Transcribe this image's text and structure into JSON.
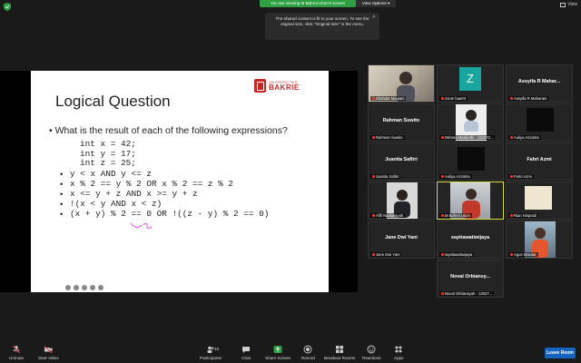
{
  "top": {
    "banner": "You are viewing M Bahrul Ulum's screen",
    "view_options": "View Options",
    "view_label": "View"
  },
  "tooltip": {
    "text": "The shared content is fit to your screen. To see the original size, click \"Original size\" in the menu."
  },
  "slide": {
    "title": "Logical Question",
    "logo_university": "UNIVERSITAS",
    "logo_name": "BAKRIE",
    "question": "• What is the result of each of the following expressions?",
    "code": [
      "int x = 42;",
      "int y = 17;",
      "int z = 25;"
    ],
    "expressions": [
      "y < x AND y <= z",
      "x % 2 == y % 2 OR x % 2 == z % 2",
      "x <= y + z AND x >= y + z",
      "!(x < y AND x < z)",
      "(x + y) % 2 == 0 OR !((z - y) % 2 == 0)"
    ]
  },
  "gallery": [
    {
      "name": "",
      "label": "Shahdat Maulani"
    },
    {
      "name": "",
      "label": "zoom baa04",
      "avatar_letter": "Z"
    },
    {
      "name": "Assyifa R Mahar...",
      "label": "Assyifa R Maharani"
    },
    {
      "name": "Rahman Suwito",
      "label": "Rahman Suwito"
    },
    {
      "name": "",
      "label": "Debora Marianthi - 122072..."
    },
    {
      "name": "",
      "label": "Auliya Azzahra"
    },
    {
      "name": "Juanita Safitri",
      "label": "Juanita Safitri"
    },
    {
      "name": "",
      "label": "Auliya Azzahra"
    },
    {
      "name": "Fahri Azmi",
      "label": "Fahri Azmi"
    },
    {
      "name": "",
      "label": "Afifi Nadiansyah"
    },
    {
      "name": "",
      "label": "M Bahrul Ulum"
    },
    {
      "name": "",
      "label": "Rian Nispradi"
    },
    {
      "name": "Jane Dwi Yani",
      "label": "Jane Dwi Yani"
    },
    {
      "name": "septiawatiwijaya",
      "label": "septiawatiwijaya"
    },
    {
      "name": "",
      "label": "Agus Masdar"
    },
    {
      "name": "Noval Orbiansy...",
      "label": "Noval Orbiansyah - 12027..."
    }
  ],
  "toolbar": {
    "unmute": "Unmute",
    "start_video": "Start Video",
    "participants": "Participants",
    "participants_count": "16",
    "chat": "Chat",
    "share_screen": "Share Screen",
    "record": "Record",
    "breakout": "Breakout Rooms",
    "reactions": "Reactions",
    "apps": "Apps",
    "leave": "Leave Room"
  },
  "colors": {
    "banner_green": "#2ea043",
    "leave_blue": "#1565c0",
    "active_speaker": "#d7e045",
    "brand_red": "#c62828"
  }
}
